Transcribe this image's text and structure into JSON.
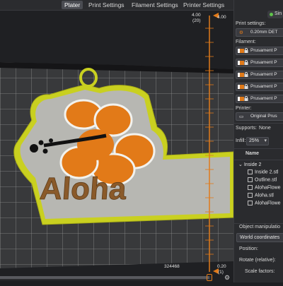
{
  "tabs": [
    {
      "label": "Plater",
      "active": true
    },
    {
      "label": "Print Settings",
      "active": false
    },
    {
      "label": "Filament Settings",
      "active": false
    },
    {
      "label": "Printer Settings",
      "active": false
    }
  ],
  "viewport": {
    "model_text": "Aloha",
    "coord_readout": "324468",
    "vslider_top": {
      "value": "4.00",
      "layer": "(20)"
    },
    "vslider_top_right": "4.00",
    "vslider_bottom": {
      "value": "0.20",
      "layer": "(1)"
    }
  },
  "panel": {
    "mode_label": "Sin",
    "print_settings_label": "Print settings:",
    "print_settings_value": "0.20mm DET",
    "filament_label": "Filament:",
    "filaments": [
      "Prusament P",
      "Prusament P",
      "Prusament P",
      "Prusament P",
      "Prusament P"
    ],
    "printer_label": "Printer:",
    "printer_value": "Original Prus",
    "supports_label": "Supports:",
    "supports_value": "None",
    "infill_label": "Infill:",
    "infill_value": "25%",
    "name_header": "Name",
    "object_name": "Inside 2",
    "parts": [
      "Inside 2.stl",
      "Outline.stl",
      "AlohaFlowe",
      "Aloha.stl",
      "AlohaFlowe"
    ],
    "object_manipulation": "Object manipulatio",
    "world_coordinates": "World coordinates",
    "position_label": "Position:",
    "rotate_label": "Rotate (relative):",
    "scale_label": "Scale factors:"
  },
  "colors": {
    "accent": "#e07a1a",
    "outline_yellow": "#c8d021",
    "text_brown": "#8a5a2a",
    "bed": "#3a3a3c"
  }
}
